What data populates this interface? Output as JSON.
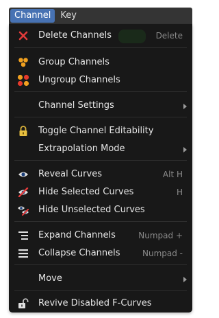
{
  "menubar": {
    "tabs": [
      {
        "label": "Channel",
        "active": true
      },
      {
        "label": "Key",
        "active": false
      }
    ]
  },
  "menu": {
    "items": [
      {
        "label": "Delete Channels",
        "shortcut": "Delete",
        "icon": "x-icon"
      },
      {
        "label": "Group Channels",
        "icon": "group-icon"
      },
      {
        "label": "Ungroup Channels",
        "icon": "ungroup-icon"
      },
      {
        "label": "Channel Settings",
        "submenu": true
      },
      {
        "label": "Toggle Channel Editability",
        "icon": "lock-icon"
      },
      {
        "label": "Extrapolation Mode",
        "submenu": true
      },
      {
        "label": "Reveal Curves",
        "shortcut": "Alt H",
        "icon": "eye-icon"
      },
      {
        "label": "Hide Selected Curves",
        "shortcut": "H",
        "icon": "hide-selected-icon"
      },
      {
        "label": "Hide Unselected Curves",
        "icon": "hide-unselected-icon"
      },
      {
        "label": "Expand Channels",
        "shortcut": "Numpad +",
        "icon": "expand-icon"
      },
      {
        "label": "Collapse Channels",
        "shortcut": "Numpad -",
        "icon": "collapse-icon"
      },
      {
        "label": "Move",
        "submenu": true
      },
      {
        "label": "Revive Disabled F-Curves",
        "icon": "unlock-icon"
      }
    ]
  },
  "colors": {
    "accent": "#4772b3",
    "menu_bg": "#181818",
    "text": "#e6e6e6",
    "shortcut": "#8a8a8a",
    "delete_red": "#e23b3b",
    "group_orange": "#f0a020"
  }
}
